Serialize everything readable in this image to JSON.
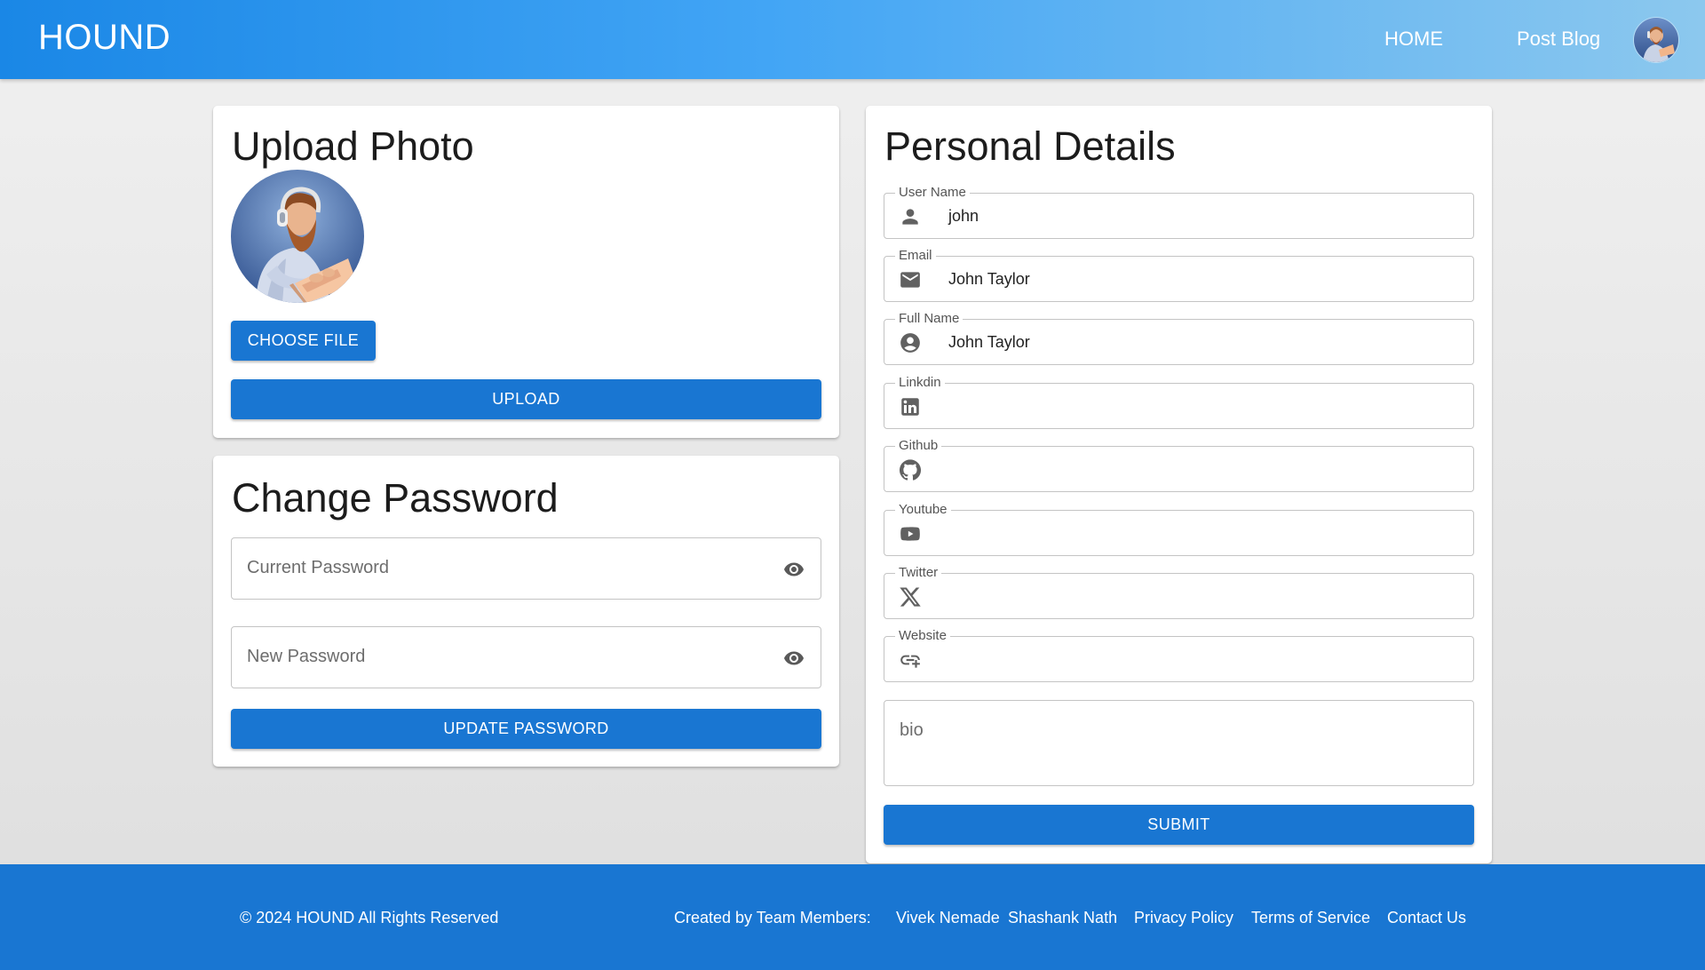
{
  "header": {
    "brand": "HOUND",
    "nav": {
      "home": "HOME",
      "post_blog": "Post Blog"
    }
  },
  "upload": {
    "title": "Upload Photo",
    "choose_label": "CHOOSE FILE",
    "upload_label": "UPLOAD"
  },
  "password": {
    "title": "Change Password",
    "current_placeholder": "Current Password",
    "new_placeholder": "New Password",
    "update_label": "UPDATE PASSWORD"
  },
  "details": {
    "title": "Personal Details",
    "fields": [
      {
        "label": "User Name",
        "value": "john",
        "icon": "person-icon"
      },
      {
        "label": "Email",
        "value": "John Taylor",
        "icon": "email-icon"
      },
      {
        "label": "Full Name",
        "value": "John Taylor",
        "icon": "account-circle-icon"
      },
      {
        "label": "Linkdin",
        "value": "",
        "icon": "linkedin-icon"
      },
      {
        "label": "Github",
        "value": "",
        "icon": "github-icon"
      },
      {
        "label": "Youtube",
        "value": "",
        "icon": "youtube-icon"
      },
      {
        "label": "Twitter",
        "value": "",
        "icon": "x-twitter-icon"
      },
      {
        "label": "Website",
        "value": "",
        "icon": "add-link-icon"
      }
    ],
    "bio_placeholder": "bio",
    "submit_label": "SUBMIT"
  },
  "footer": {
    "copyright": "© 2024 HOUND All Rights Reserved",
    "created_by": "Created by Team Members:",
    "members": [
      "Vivek Nemade",
      "Shashank Nath"
    ],
    "links": {
      "privacy": "Privacy Policy",
      "terms": "Terms of Service",
      "contact": "Contact Us"
    }
  },
  "colors": {
    "primary": "#1976d2",
    "appbar_start": "#1a87e6",
    "appbar_end": "#8cc8ee",
    "icon_gray": "#616161"
  }
}
